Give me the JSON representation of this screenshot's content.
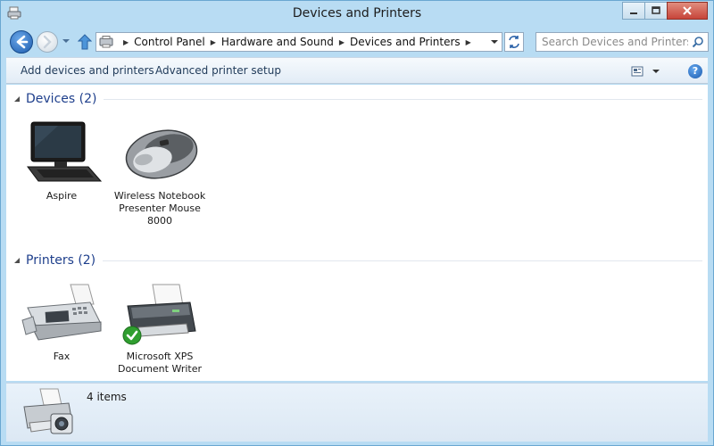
{
  "window": {
    "title": "Devices and Printers"
  },
  "address": {
    "crumbs": [
      "Control Panel",
      "Hardware and Sound",
      "Devices and Printers"
    ]
  },
  "search": {
    "placeholder": "Search Devices and Printers"
  },
  "commands": {
    "add_devices": "Add devices and printers",
    "advanced_setup": "Advanced printer setup"
  },
  "groups": {
    "devices": {
      "title": "Devices (2)",
      "items": [
        {
          "label": "Aspire",
          "icon": "laptop-icon"
        },
        {
          "label": "Wireless Notebook Presenter Mouse 8000",
          "icon": "mouse-icon"
        }
      ]
    },
    "printers": {
      "title": "Printers (2)",
      "items": [
        {
          "label": "Fax",
          "icon": "fax-icon"
        },
        {
          "label": "Microsoft XPS Document Writer",
          "icon": "printer-icon",
          "default": true
        }
      ]
    }
  },
  "details": {
    "count": "4 items"
  },
  "colors": {
    "accent": "#1e3f8c",
    "frame": "#b8dcf3",
    "close": "#c7453a",
    "default_check": "#2f9e2f"
  }
}
